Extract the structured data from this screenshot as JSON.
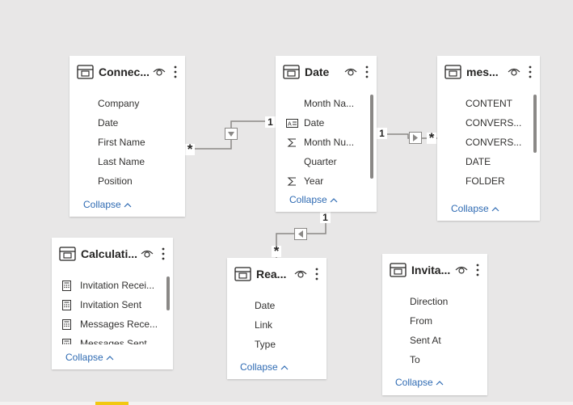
{
  "tables": {
    "connections": {
      "title": "Connec...",
      "fields": [
        "Company",
        "Date",
        "First Name",
        "Last Name",
        "Position"
      ],
      "collapse_label": "Collapse"
    },
    "date": {
      "title": "Date",
      "fields": [
        "Month Na...",
        "Date",
        "Month Nu...",
        "Quarter",
        "Year"
      ],
      "field_icons": [
        "none",
        "date-hierarchy-icon",
        "sigma-icon",
        "none",
        "sigma-icon"
      ],
      "collapse_label": "Collapse"
    },
    "messages": {
      "title": "mes...",
      "fields": [
        "CONTENT",
        "CONVERS...",
        "CONVERS...",
        "DATE",
        "FOLDER"
      ],
      "collapse_label": "Collapse"
    },
    "calculations": {
      "title": "Calculati...",
      "fields": [
        "Invitation Recei...",
        "Invitation Sent",
        "Messages Rece...",
        "Messages Sent"
      ],
      "field_icons": [
        "calculator-icon",
        "calculator-icon",
        "calculator-icon",
        "calculator-icon"
      ],
      "collapse_label": "Collapse"
    },
    "reactions": {
      "title": "Rea...",
      "fields": [
        "Date",
        "Link",
        "Type"
      ],
      "collapse_label": "Collapse"
    },
    "invitations": {
      "title": "Invita...",
      "fields": [
        "Direction",
        "From",
        "Sent At",
        "To"
      ],
      "collapse_label": "Collapse"
    }
  },
  "relationships": {
    "connections_date": {
      "many": "*",
      "one": "1"
    },
    "date_messages": {
      "one": "1",
      "many": "*"
    },
    "date_reactions": {
      "one": "1",
      "many": "*"
    }
  },
  "colors": {
    "canvas": "#e8e7e7",
    "card": "#ffffff",
    "link": "#2f6bb3",
    "line": "#8a8886",
    "accent_tab": "#f2c811"
  }
}
